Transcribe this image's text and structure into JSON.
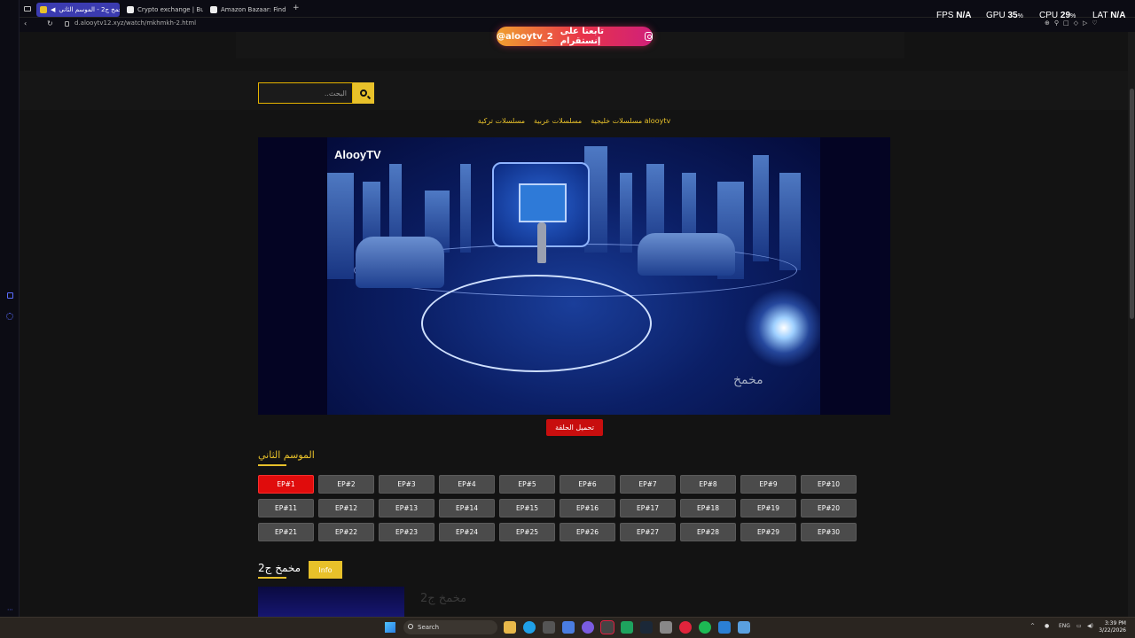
{
  "browser": {
    "tabs": [
      {
        "label": "مخمخ ج2 - الموسم الثاني",
        "active": true
      },
      {
        "label": "Crypto exchange | Buy cr",
        "active": false
      },
      {
        "label": "Amazon Bazaar: Find new",
        "active": false
      }
    ],
    "new_tab": "+",
    "url": "d.alooytv12.xyz/watch/mkhmkh-2.html"
  },
  "overlay": {
    "fps_label": "FPS",
    "fps_value": "N/A",
    "gpu_label": "GPU",
    "gpu_value": "35",
    "cpu_label": "CPU",
    "cpu_value": "29",
    "lat_label": "LAT",
    "lat_value": "N/A",
    "percent": "%"
  },
  "header": {
    "instagram_text": "تابعنا على إنستقرام",
    "instagram_handle": "@alooytv_2"
  },
  "search": {
    "placeholder": "البحث.."
  },
  "categories": [
    "alooytv مسلسلات خليجية",
    "مسلسلات عربية",
    "مسلسلات تركية"
  ],
  "player": {
    "logo": "AlooyTV",
    "watermark": "مخمخ"
  },
  "download_label": "تحميل الحلقة",
  "season_title": "الموسم الثاني",
  "episodes": [
    "EP#1",
    "EP#2",
    "EP#3",
    "EP#4",
    "EP#5",
    "EP#6",
    "EP#7",
    "EP#8",
    "EP#9",
    "EP#10",
    "EP#11",
    "EP#12",
    "EP#13",
    "EP#14",
    "EP#15",
    "EP#16",
    "EP#17",
    "EP#18",
    "EP#19",
    "EP#20",
    "EP#21",
    "EP#22",
    "EP#23",
    "EP#24",
    "EP#25",
    "EP#26",
    "EP#27",
    "EP#28",
    "EP#29",
    "EP#30"
  ],
  "active_episode": "EP#1",
  "show": {
    "title": "مخمخ ج2",
    "info_label": "Info",
    "card_title": "مخمخ ج2"
  },
  "taskbar": {
    "search_label": "Search",
    "lang": "ENG",
    "time": "3:39 PM",
    "date": "3/22/2026"
  },
  "colors": {
    "accent": "#e8c12a",
    "active": "#e00c0c",
    "download": "#c80e0e"
  }
}
